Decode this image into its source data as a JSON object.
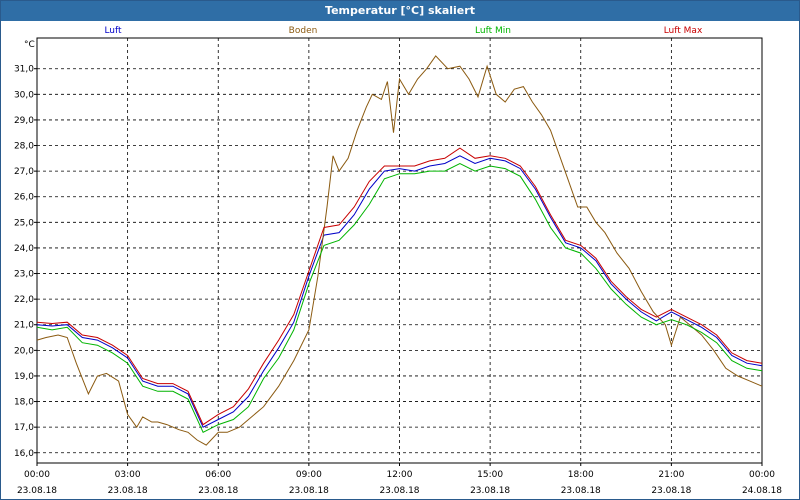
{
  "window": {
    "title": "Temperatur [°C] skaliert"
  },
  "chart_data": {
    "type": "line",
    "unit_label": "°C",
    "ylim": [
      15.6,
      32.2
    ],
    "y_ticks": [
      "16,0",
      "17,0",
      "18,0",
      "19,0",
      "20,0",
      "21,0",
      "22,0",
      "23,0",
      "24,0",
      "25,0",
      "26,0",
      "27,0",
      "28,0",
      "29,0",
      "30,0",
      "31,0"
    ],
    "y_tick_values": [
      16,
      17,
      18,
      19,
      20,
      21,
      22,
      23,
      24,
      25,
      26,
      27,
      28,
      29,
      30,
      31
    ],
    "x_range_hours": [
      0,
      24
    ],
    "x_ticks": [
      {
        "time": "00:00",
        "date": "23.08.18",
        "hour": 0
      },
      {
        "time": "03:00",
        "date": "23.08.18",
        "hour": 3
      },
      {
        "time": "06:00",
        "date": "23.08.18",
        "hour": 6
      },
      {
        "time": "09:00",
        "date": "23.08.18",
        "hour": 9
      },
      {
        "time": "12:00",
        "date": "23.08.18",
        "hour": 12
      },
      {
        "time": "15:00",
        "date": "23.08.18",
        "hour": 15
      },
      {
        "time": "18:00",
        "date": "23.08.18",
        "hour": 18
      },
      {
        "time": "21:00",
        "date": "23.08.18",
        "hour": 21
      },
      {
        "time": "00:00",
        "date": "24.08.18",
        "hour": 24
      }
    ],
    "grid": true,
    "legend_position": "top",
    "series": [
      {
        "name": "Luft",
        "color": "#0000c8",
        "x": [
          0,
          0.5,
          1,
          1.5,
          2,
          2.5,
          3,
          3.5,
          4,
          4.5,
          5,
          5.5,
          6,
          6.5,
          7,
          7.5,
          8,
          8.5,
          9,
          9.5,
          10,
          10.5,
          11,
          11.5,
          12,
          12.5,
          13,
          13.5,
          14,
          14.5,
          15,
          15.5,
          16,
          16.5,
          17,
          17.5,
          18,
          18.5,
          19,
          19.5,
          20,
          20.5,
          21,
          21.5,
          22,
          22.5,
          23,
          23.5,
          24
        ],
        "y": [
          21.0,
          20.95,
          21.0,
          20.5,
          20.4,
          20.1,
          19.7,
          18.8,
          18.6,
          18.6,
          18.3,
          17.0,
          17.3,
          17.6,
          18.2,
          19.2,
          20.1,
          21.1,
          22.9,
          24.5,
          24.6,
          25.3,
          26.3,
          27.0,
          27.1,
          27.0,
          27.2,
          27.3,
          27.6,
          27.3,
          27.5,
          27.4,
          27.1,
          26.3,
          25.2,
          24.2,
          24.0,
          23.5,
          22.6,
          22.0,
          21.5,
          21.15,
          21.5,
          21.2,
          20.9,
          20.5,
          19.8,
          19.5,
          19.4
        ]
      },
      {
        "name": "Boden",
        "color": "#8b5a10",
        "x": [
          0,
          0.3,
          0.7,
          1,
          1.3,
          1.7,
          2,
          2.3,
          2.7,
          3,
          3.3,
          3.5,
          3.8,
          4,
          4.3,
          4.7,
          5,
          5.3,
          5.6,
          6,
          6.3,
          6.7,
          7,
          7.5,
          8,
          8.5,
          9,
          9.3,
          9.6,
          9.8,
          10,
          10.3,
          10.6,
          10.9,
          11.1,
          11.4,
          11.6,
          11.8,
          12,
          12.3,
          12.6,
          12.9,
          13.2,
          13.6,
          14,
          14.3,
          14.6,
          14.9,
          15.2,
          15.5,
          15.8,
          16.1,
          16.4,
          16.7,
          17,
          17.3,
          17.6,
          17.9,
          18.2,
          18.5,
          18.8,
          19.2,
          19.6,
          20,
          20.4,
          20.8,
          21,
          21.3,
          21.6,
          22,
          22.4,
          22.8,
          23.2,
          23.6,
          24
        ],
        "y": [
          20.4,
          20.5,
          20.6,
          20.5,
          19.5,
          18.3,
          19.0,
          19.1,
          18.8,
          17.5,
          17.0,
          17.4,
          17.2,
          17.2,
          17.1,
          16.9,
          16.8,
          16.5,
          16.3,
          16.8,
          16.8,
          17.0,
          17.3,
          17.8,
          18.6,
          19.6,
          20.8,
          22.9,
          25.6,
          27.6,
          27.0,
          27.5,
          28.6,
          29.5,
          30.0,
          29.8,
          30.5,
          28.5,
          30.6,
          30.0,
          30.6,
          31.0,
          31.5,
          31.0,
          31.1,
          30.6,
          29.9,
          31.1,
          30.0,
          29.7,
          30.2,
          30.3,
          29.7,
          29.2,
          28.6,
          27.6,
          26.6,
          25.6,
          25.6,
          25.0,
          24.6,
          23.8,
          23.2,
          22.3,
          21.5,
          21.0,
          20.2,
          21.3,
          21.0,
          20.6,
          20.0,
          19.3,
          19.0,
          18.8,
          18.6
        ]
      },
      {
        "name": "Luft Min",
        "color": "#00b400",
        "x": [
          0,
          0.5,
          1,
          1.5,
          2,
          2.5,
          3,
          3.5,
          4,
          4.5,
          5,
          5.5,
          6,
          6.5,
          7,
          7.5,
          8,
          8.5,
          9,
          9.5,
          10,
          10.5,
          11,
          11.5,
          12,
          12.5,
          13,
          13.5,
          14,
          14.5,
          15,
          15.5,
          16,
          16.5,
          17,
          17.5,
          18,
          18.5,
          19,
          19.5,
          20,
          20.5,
          21,
          21.5,
          22,
          22.5,
          23,
          23.5,
          24
        ],
        "y": [
          20.9,
          20.8,
          20.9,
          20.3,
          20.2,
          19.9,
          19.5,
          18.6,
          18.4,
          18.4,
          18.1,
          16.8,
          17.1,
          17.3,
          17.8,
          18.9,
          19.7,
          20.8,
          22.6,
          24.1,
          24.3,
          24.9,
          25.7,
          26.7,
          26.9,
          26.9,
          27.0,
          27.0,
          27.3,
          27.0,
          27.2,
          27.1,
          26.8,
          25.9,
          24.8,
          24.0,
          23.8,
          23.2,
          22.4,
          21.8,
          21.3,
          21.0,
          21.2,
          21.0,
          20.7,
          20.3,
          19.6,
          19.3,
          19.2
        ]
      },
      {
        "name": "Luft Max",
        "color": "#c80000",
        "x": [
          0,
          0.5,
          1,
          1.5,
          2,
          2.5,
          3,
          3.5,
          4,
          4.5,
          5,
          5.5,
          6,
          6.5,
          7,
          7.5,
          8,
          8.5,
          9,
          9.5,
          10,
          10.5,
          11,
          11.5,
          12,
          12.5,
          13,
          13.5,
          14,
          14.5,
          15,
          15.5,
          16,
          16.5,
          17,
          17.5,
          18,
          18.5,
          19,
          19.5,
          20,
          20.5,
          21,
          21.5,
          22,
          22.5,
          23,
          23.5,
          24
        ],
        "y": [
          21.1,
          21.05,
          21.1,
          20.6,
          20.5,
          20.2,
          19.8,
          18.9,
          18.7,
          18.7,
          18.4,
          17.1,
          17.5,
          17.8,
          18.5,
          19.5,
          20.4,
          21.4,
          23.1,
          24.8,
          24.9,
          25.6,
          26.6,
          27.2,
          27.2,
          27.2,
          27.4,
          27.5,
          27.9,
          27.5,
          27.6,
          27.5,
          27.2,
          26.4,
          25.3,
          24.3,
          24.1,
          23.6,
          22.7,
          22.1,
          21.6,
          21.3,
          21.6,
          21.3,
          21.0,
          20.6,
          19.9,
          19.6,
          19.5
        ]
      }
    ]
  }
}
